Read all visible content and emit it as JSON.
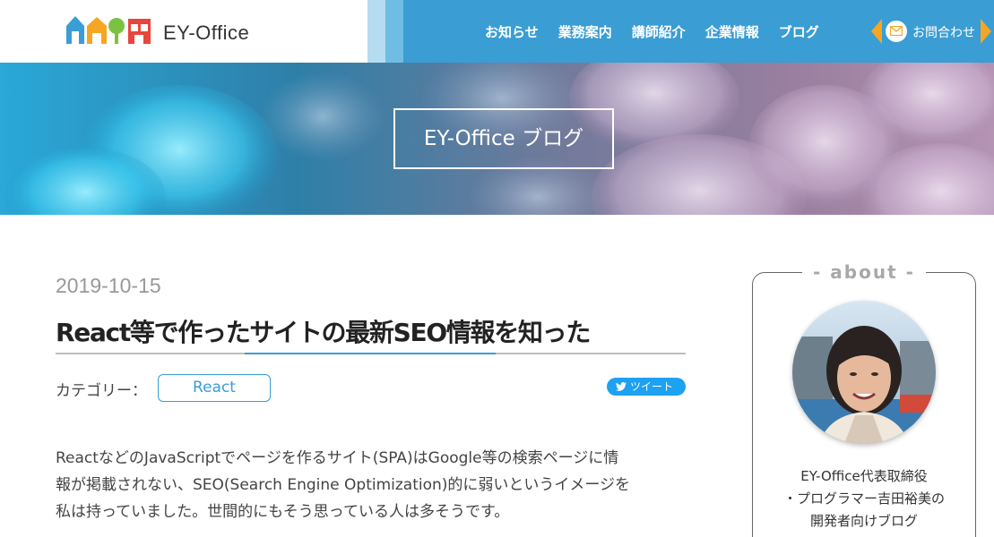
{
  "header": {
    "logo_text": "EY-Office",
    "nav": [
      {
        "label": "お知らせ"
      },
      {
        "label": "業務案内"
      },
      {
        "label": "講師紹介"
      },
      {
        "label": "企業情報"
      },
      {
        "label": "ブログ"
      }
    ],
    "contact_label": "お問合わせ",
    "contact_icon": "mail-icon",
    "colors": {
      "header_bg": "#3a9dd4",
      "contact_accent": "#f5a623"
    }
  },
  "hero": {
    "title": "EY-Office ブログ"
  },
  "post": {
    "date": "2019-10-15",
    "title": "React等で作ったサイトの最新SEO情報を知った",
    "category_label": "カテゴリー：",
    "category_tag": "React",
    "tweet_label": "ツイート",
    "tweet_icon": "twitter-bird-icon",
    "body_lines": [
      "ReactなどのJavaScriptでページを作るサイト(SPA)はGoogle等の検索ページに情",
      "報が掲載されない、SEO(Search Engine Optimization)的に弱いというイメージを",
      "私は持っていました。世間的にもそう思っている人は多そうです。"
    ],
    "colors": {
      "accent": "#3a9dd4",
      "tweet": "#1da1f2"
    }
  },
  "sidebar": {
    "heading": "- about -",
    "avatar_icon": "author-photo",
    "lines": [
      "EY-Office代表取締役",
      "・プログラマー吉田裕美の",
      "開発者向けブログ"
    ]
  }
}
